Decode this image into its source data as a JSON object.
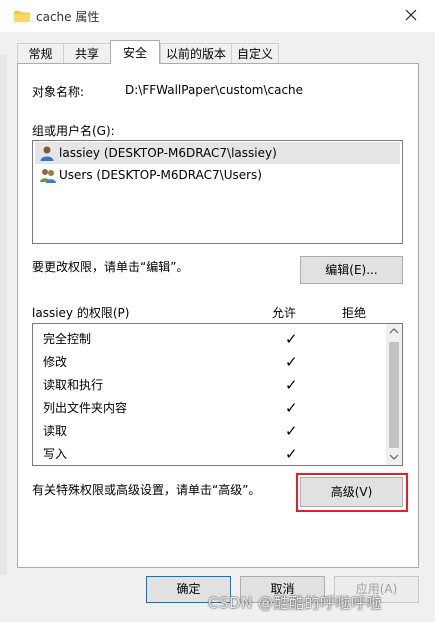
{
  "window": {
    "title": "cache 属性",
    "close_icon": "close-icon",
    "folder_icon": "folder-icon"
  },
  "tabs": [
    {
      "label": "常规"
    },
    {
      "label": "共享"
    },
    {
      "label": "安全",
      "active": true
    },
    {
      "label": "以前的版本"
    },
    {
      "label": "自定义"
    }
  ],
  "object": {
    "label": "对象名称:",
    "value": "D:\\FFWallPaper\\custom\\cache"
  },
  "groups": {
    "label": "组或用户名(G):",
    "items": [
      {
        "name": "lassiey (DESKTOP-M6DRAC7\\lassiey)",
        "icon": "user-icon",
        "selected": true
      },
      {
        "name": "Users (DESKTOP-M6DRAC7\\Users)",
        "icon": "users-group-icon",
        "selected": false
      }
    ]
  },
  "edit": {
    "hint": "要更改权限，请单击“编辑”。",
    "button": "编辑(E)..."
  },
  "permissions": {
    "label": "lassiey 的权限(P)",
    "allow_header": "允许",
    "deny_header": "拒绝",
    "check_glyph": "✓",
    "rows": [
      {
        "name": "完全控制",
        "allow": true,
        "deny": false
      },
      {
        "name": "修改",
        "allow": true,
        "deny": false
      },
      {
        "name": "读取和执行",
        "allow": true,
        "deny": false
      },
      {
        "name": "列出文件夹内容",
        "allow": true,
        "deny": false
      },
      {
        "name": "读取",
        "allow": true,
        "deny": false
      },
      {
        "name": "写入",
        "allow": true,
        "deny": false
      }
    ]
  },
  "advanced": {
    "hint": "有关特殊权限或高级设置，请单击“高级”。",
    "button": "高级(V)",
    "highlight_color": "#e81e25"
  },
  "footer": {
    "ok": "确定",
    "cancel": "取消",
    "apply": "应用(A)"
  },
  "watermark": "CSDN @酷酷的呼啦呼啦"
}
